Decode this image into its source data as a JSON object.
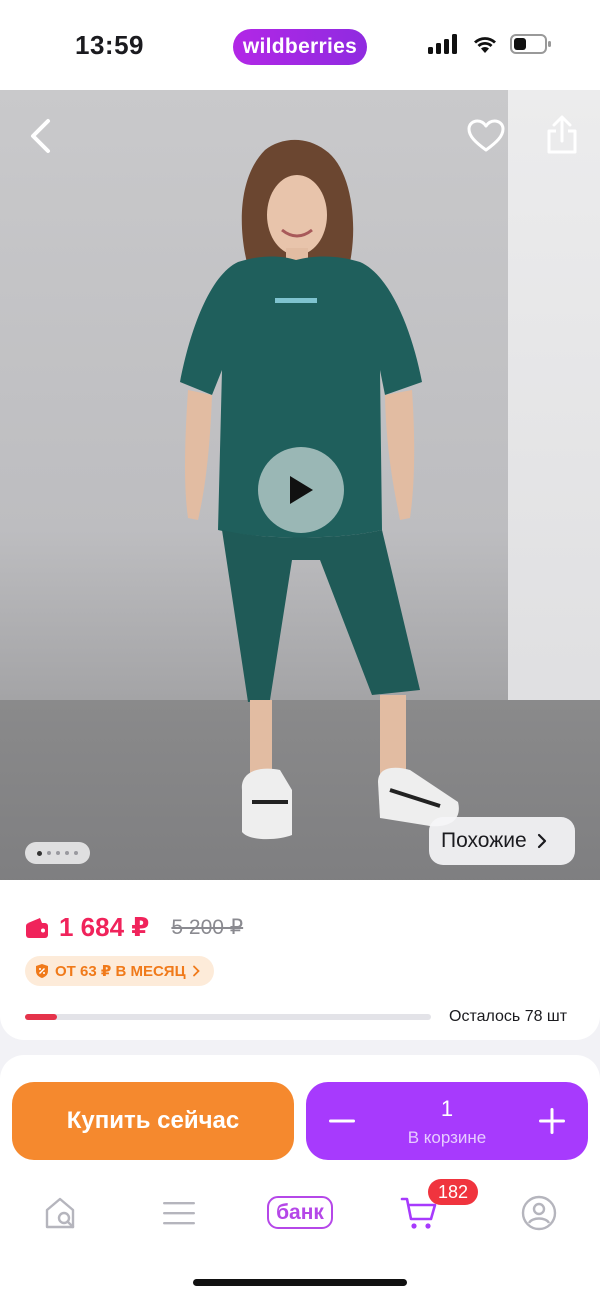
{
  "status_bar": {
    "time": "13:59",
    "brand": "wildberries"
  },
  "hero": {
    "similar_label": "Похожие",
    "slides_total": 5,
    "slide_active": 1
  },
  "product": {
    "price_now": "1 684 ₽",
    "price_old": "5 200 ₽",
    "installment": "ОТ 63 ₽ В МЕСЯЦ",
    "stock_text": "Осталось 78 шт",
    "stock_fraction": 0.08
  },
  "actions": {
    "buy_now": "Купить сейчас",
    "cart_qty": "1",
    "cart_label": "В корзине"
  },
  "tabbar": {
    "bank_label": "банк",
    "cart_badge": "182"
  },
  "colors": {
    "accent_purple": "#a73afd",
    "buy_orange": "#f5892e",
    "price_red": "#f0235b"
  }
}
